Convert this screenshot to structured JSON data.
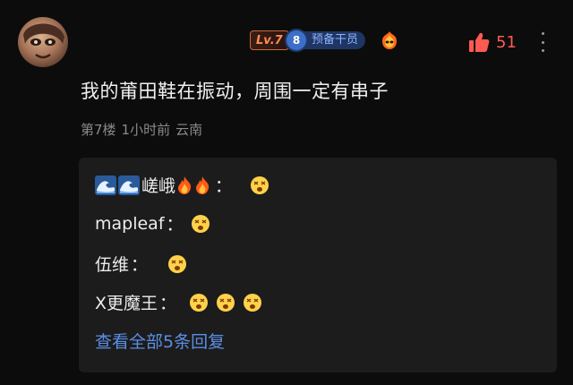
{
  "comment": {
    "level_badge": "Lv.7",
    "cadre_badge": {
      "number": "8",
      "label": "预备干员"
    },
    "medal_icon": "flame-mask-icon",
    "like_count": "51",
    "text": "我的莆田鞋在振动，周围一定有串子",
    "floor": "第7楼",
    "time": "1小时前",
    "location": "云南"
  },
  "replies": [
    {
      "name": "嵯峨",
      "sep": "：",
      "name_prefix_icons": [
        "wave-icon",
        "wave-icon"
      ],
      "name_suffix_icons": [
        "fire-icon",
        "fire-icon"
      ],
      "emoji_count": 1
    },
    {
      "name": "mapleaf",
      "sep": "：",
      "emoji_count": 1
    },
    {
      "name": "伍维",
      "sep": "：",
      "emoji_count": 1
    },
    {
      "name": "X更魔王",
      "sep": "：",
      "emoji_count": 3
    }
  ],
  "view_all_label": "查看全部5条回复",
  "colors": {
    "accent_red": "#ff5a52",
    "link_blue": "#5b8ee6",
    "level_orange": "#ff8d55",
    "cadre_blue": "#3d6fc7"
  }
}
